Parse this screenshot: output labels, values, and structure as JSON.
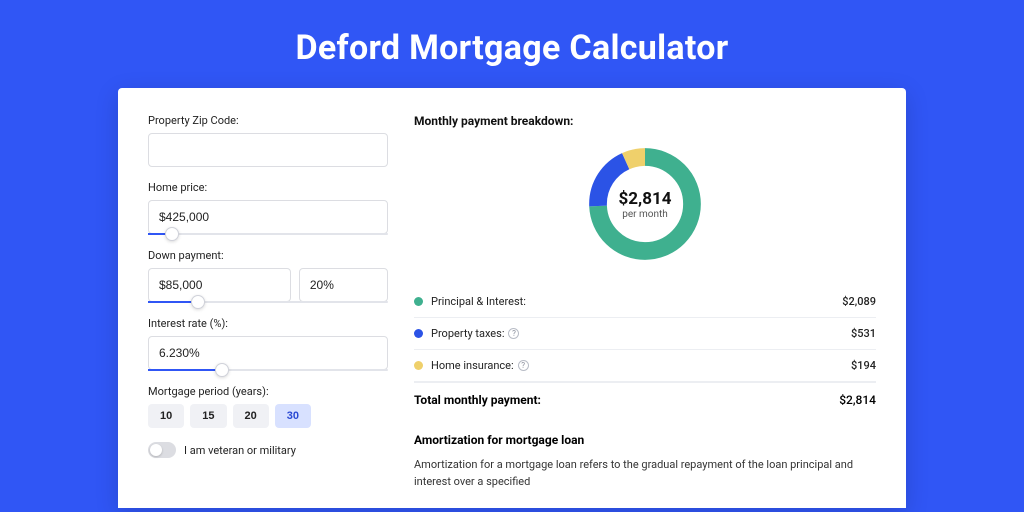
{
  "title": "Deford Mortgage Calculator",
  "form": {
    "zip": {
      "label": "Property Zip Code:",
      "value": ""
    },
    "home_price": {
      "label": "Home price:",
      "value": "$425,000",
      "slider_pct": 10
    },
    "down_payment": {
      "label": "Down payment:",
      "amount": "$85,000",
      "percent": "20%",
      "slider_pct": 21
    },
    "interest_rate": {
      "label": "Interest rate (%):",
      "value": "6.230%",
      "slider_pct": 31
    },
    "period": {
      "label": "Mortgage period (years):",
      "options": [
        "10",
        "15",
        "20",
        "30"
      ],
      "selected": "30"
    },
    "veteran": {
      "label": "I am veteran or military",
      "checked": false
    }
  },
  "breakdown": {
    "heading": "Monthly payment breakdown:",
    "total_value": "$2,814",
    "total_sub": "per month",
    "items": [
      {
        "key": "pi",
        "label": "Principal & Interest:",
        "amount": "$2,089",
        "color": "#3fb08f",
        "info": false
      },
      {
        "key": "tax",
        "label": "Property taxes:",
        "amount": "$531",
        "color": "#2b53e6",
        "info": true
      },
      {
        "key": "ins",
        "label": "Home insurance:",
        "amount": "$194",
        "color": "#efd06b",
        "info": true
      }
    ],
    "total_row": {
      "label": "Total monthly payment:",
      "amount": "$2,814"
    }
  },
  "amortization": {
    "heading": "Amortization for mortgage loan",
    "body": "Amortization for a mortgage loan refers to the gradual repayment of the loan principal and interest over a specified"
  },
  "chart_data": {
    "type": "pie",
    "title": "Monthly payment breakdown",
    "categories": [
      "Principal & Interest",
      "Property taxes",
      "Home insurance"
    ],
    "values": [
      2089,
      531,
      194
    ],
    "colors": [
      "#3fb08f",
      "#2b53e6",
      "#efd06b"
    ],
    "center_label": "$2,814 per month"
  }
}
